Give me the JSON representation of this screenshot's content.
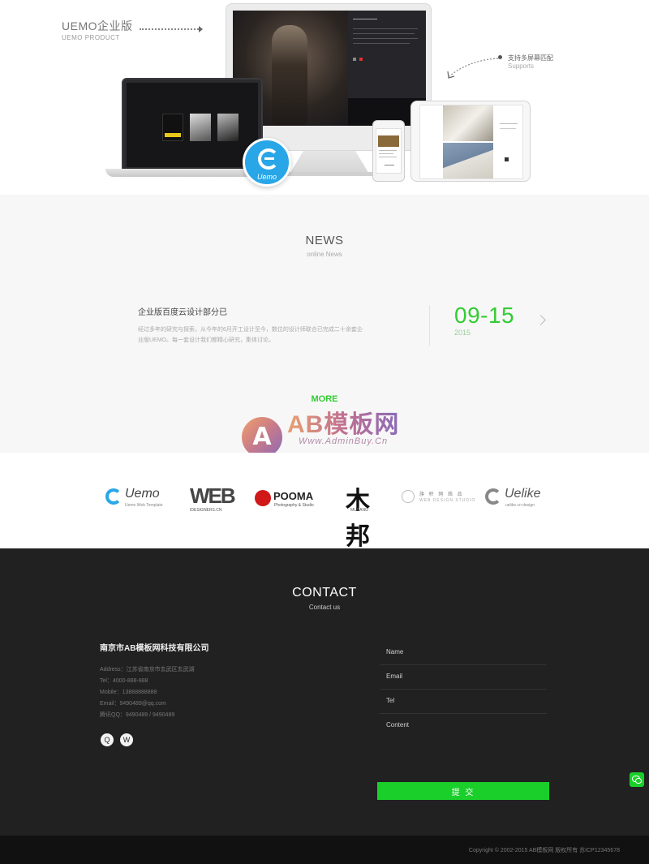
{
  "hero": {
    "brand_title": "UEMO企业版",
    "brand_subtitle": "UEMO PRODUCT",
    "support_title": "支持多屏幕匹配",
    "support_subtitle": "Supports",
    "logo_text": "Uemo"
  },
  "news": {
    "title": "NEWS",
    "subtitle": "online News",
    "item": {
      "title": "企业版百度云设计部分已",
      "desc": "经过多年的研究与探索，从今年的6月开工设计至今，数位的设计师联合已完成二十余套企业版UEMO。每一套设计我们都精心研究，集体讨论。",
      "date": "09-15",
      "year": "2015"
    },
    "more_label": "MORE"
  },
  "watermark": {
    "letter": "A",
    "text": "AB模板网",
    "url": "Www.AdminBuy.Cn"
  },
  "partners": [
    {
      "name": "Uemo",
      "sub": "Uemo Web Template"
    },
    {
      "name": "WEB",
      "sub": "IDESIGNERS.CN"
    },
    {
      "name": "POOMA",
      "sub": "Photography & Studio"
    },
    {
      "name": "木邦",
      "sub": "MUBANG"
    },
    {
      "name": "旗 帜 网 络 品",
      "sub": "WEB DESIGN STUDIO"
    },
    {
      "name": "Uelike",
      "sub": "uelike.cn design"
    }
  ],
  "contact": {
    "title": "CONTACT",
    "subtitle": "Contact us",
    "company": "南京市AB模板网科技有限公司",
    "address": "Address：江苏省南京市玄武区玄武湖",
    "tel": "Tel：4000-888-888",
    "mobile": "Mobile：13888888888",
    "email": "Email：9490489@qq.com",
    "qq": "腾讯QQ：9490489 / 9490489",
    "social_qq": "Q",
    "social_wechat": "W",
    "form": {
      "name_placeholder": "Name",
      "email_placeholder": "Email",
      "tel_placeholder": "Tel",
      "content_placeholder": "Content",
      "submit_label": "提 交"
    }
  },
  "footer": {
    "copyright": "Copyright © 2002-2015 AB模板网 版权所有 苏ICP12345678"
  },
  "colors": {
    "accent": "#33cc33",
    "submit": "#1bcf2b",
    "dark_bg": "#212121",
    "footer_bg": "#111111",
    "uemo_blue": "#29a6e8"
  }
}
